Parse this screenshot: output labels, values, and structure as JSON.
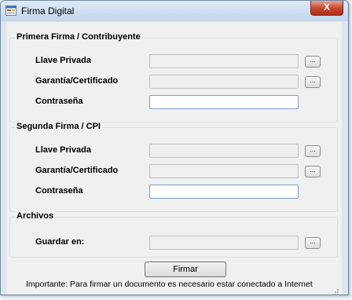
{
  "window": {
    "title": "Firma Digital",
    "close_label": "X"
  },
  "groups": [
    {
      "title": "Primera Firma / Contribuyente",
      "rows": [
        {
          "label": "Llave Privada",
          "value": "",
          "browse": "..."
        },
        {
          "label": "Garantía/Certificado",
          "value": "",
          "browse": "..."
        },
        {
          "label": "Contraseña",
          "value": ""
        }
      ]
    },
    {
      "title": "Segunda Firma / CPI",
      "rows": [
        {
          "label": "Llave Privada",
          "value": "",
          "browse": "..."
        },
        {
          "label": "Garantía/Certificado",
          "value": "",
          "browse": "..."
        },
        {
          "label": "Contraseña",
          "value": ""
        }
      ]
    },
    {
      "title": "Archivos",
      "rows": [
        {
          "label": "Guardar en:",
          "value": "",
          "browse": "..."
        }
      ]
    }
  ],
  "actions": {
    "sign_label": "Firmar"
  },
  "footer": {
    "note": "Importante: Para firmar un documento es necesario estar conectado a Internet"
  }
}
